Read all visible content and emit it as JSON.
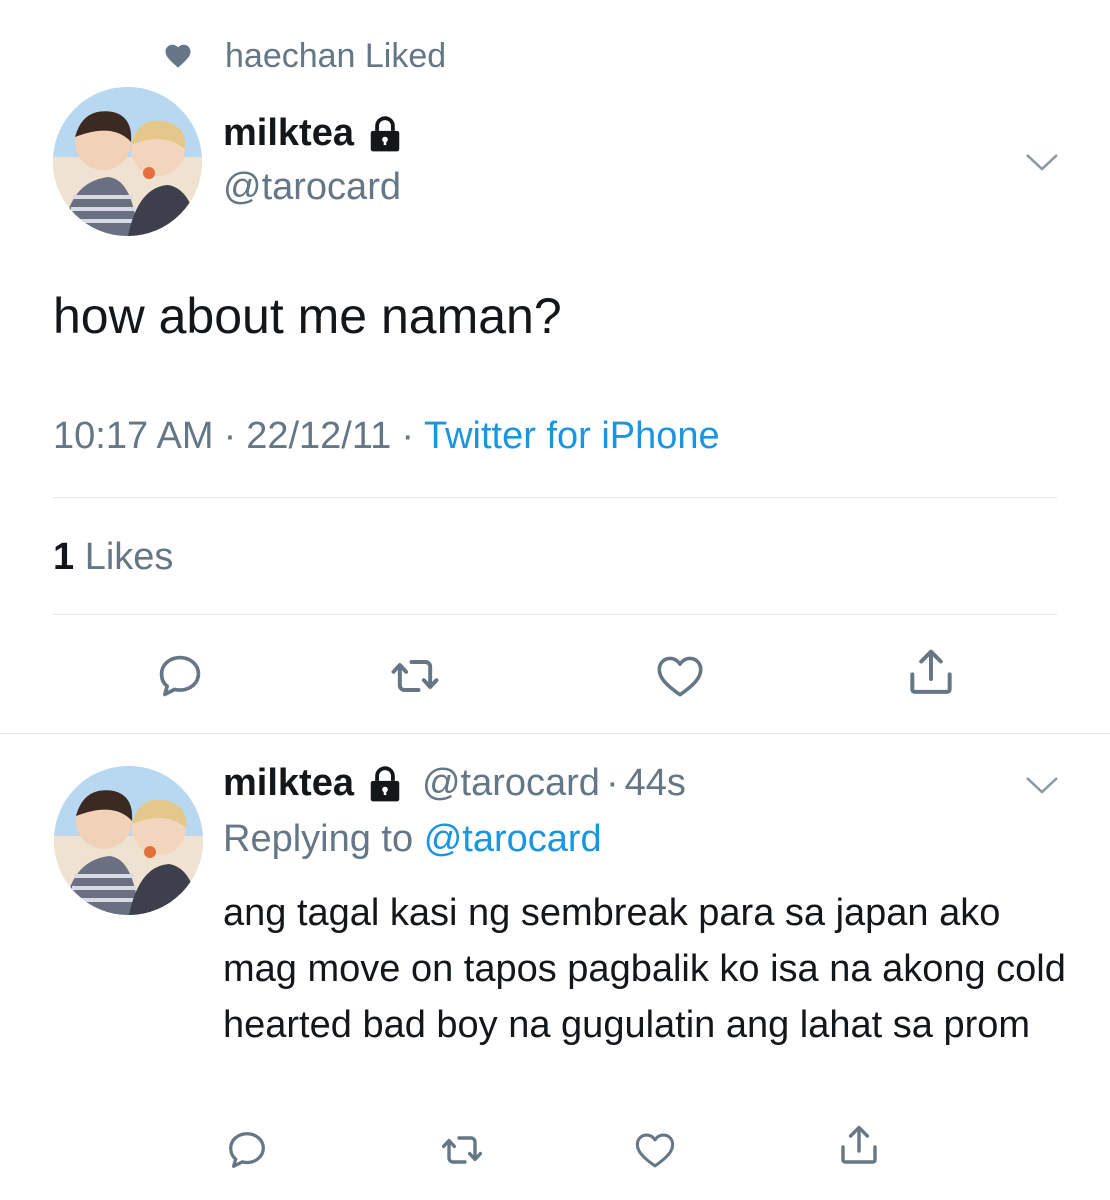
{
  "social_context": {
    "icon": "heart-icon",
    "text": "haechan Liked"
  },
  "main_tweet": {
    "name": "milktea",
    "handle": "@tarocard",
    "text": "how about me naman?",
    "time": "10:17 AM",
    "date": "22/12/11",
    "separator": "·",
    "source": "Twitter for iPhone",
    "likes_count": "1",
    "likes_label": "Likes"
  },
  "reply_tweet": {
    "name": "milktea",
    "handle": "@tarocard",
    "dot": "·",
    "time_ago": "44s",
    "replying_label": "Replying to",
    "replying_to": "@tarocard",
    "text": "ang tagal kasi ng sembreak para sa japan ako mag move on tapos pagbalik ko isa na akong cold hearted bad boy na gugulatin ang lahat sa prom"
  },
  "colors": {
    "text_primary": "#14171a",
    "text_secondary": "#657786",
    "link": "#1b95e0",
    "divider": "#e1e8ed"
  }
}
